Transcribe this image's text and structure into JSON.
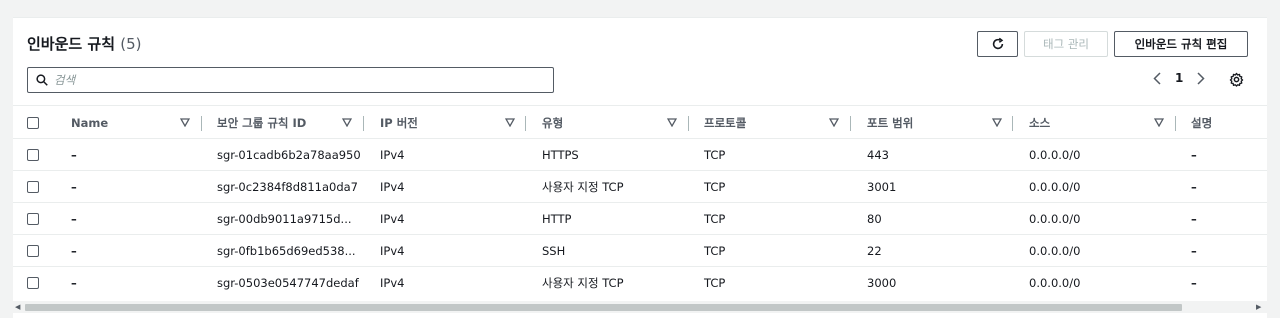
{
  "header": {
    "title": "인바운드 규칙",
    "count": "(5)",
    "refresh_icon": "refresh-icon",
    "manage_tags_label": "태그 관리",
    "edit_rules_label": "인바운드 규칙 편집"
  },
  "search": {
    "placeholder": "검색",
    "icon": "search-icon"
  },
  "pagination": {
    "current_page": "1"
  },
  "columns": [
    "Name",
    "보안 그룹 규칙 ID",
    "IP 버전",
    "유형",
    "프로토콜",
    "포트 범위",
    "소스",
    "설명"
  ],
  "rows": [
    {
      "name": "–",
      "rule_id": "sgr-01cadb6b2a78aa950",
      "ip_version": "IPv4",
      "type": "HTTPS",
      "protocol": "TCP",
      "port_range": "443",
      "source": "0.0.0.0/0",
      "description": "–"
    },
    {
      "name": "–",
      "rule_id": "sgr-0c2384f8d811a0da7",
      "ip_version": "IPv4",
      "type": "사용자 지정 TCP",
      "protocol": "TCP",
      "port_range": "3001",
      "source": "0.0.0.0/0",
      "description": "–"
    },
    {
      "name": "–",
      "rule_id": "sgr-00db9011a9715d...",
      "ip_version": "IPv4",
      "type": "HTTP",
      "protocol": "TCP",
      "port_range": "80",
      "source": "0.0.0.0/0",
      "description": "–"
    },
    {
      "name": "–",
      "rule_id": "sgr-0fb1b65d69ed538...",
      "ip_version": "IPv4",
      "type": "SSH",
      "protocol": "TCP",
      "port_range": "22",
      "source": "0.0.0.0/0",
      "description": "–"
    },
    {
      "name": "–",
      "rule_id": "sgr-0503e0547747dedaf",
      "ip_version": "IPv4",
      "type": "사용자 지정 TCP",
      "protocol": "TCP",
      "port_range": "3000",
      "source": "0.0.0.0/0",
      "description": "–"
    }
  ]
}
